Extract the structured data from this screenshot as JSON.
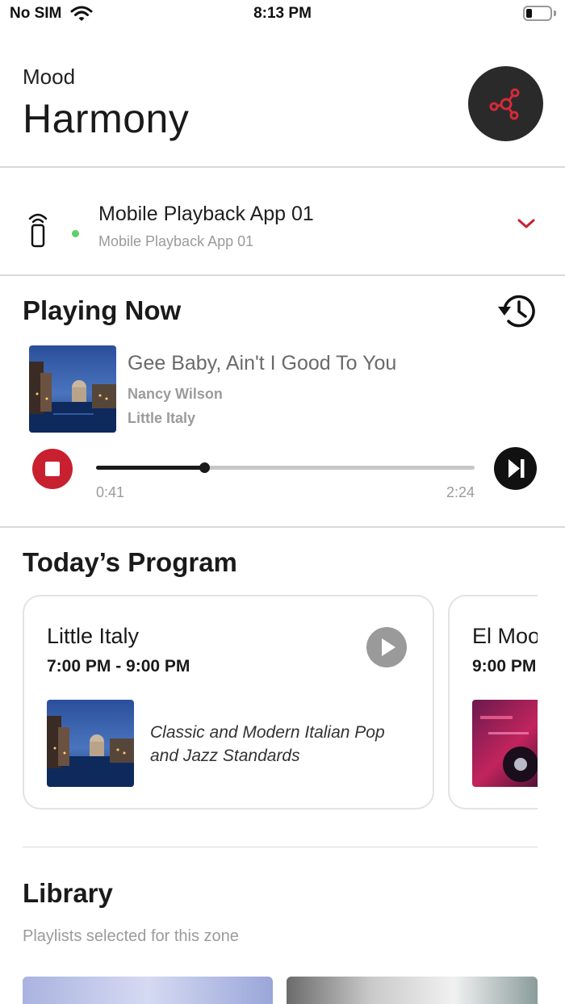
{
  "status_bar": {
    "carrier": "No SIM",
    "time": "8:13 PM",
    "battery_level": 0.25
  },
  "header": {
    "label": "Mood",
    "title": "Harmony",
    "mood_button_icon": "hub-network-icon"
  },
  "zone": {
    "name": "Mobile Playback App 01",
    "subtitle": "Mobile Playback App 01",
    "status_color": "#5ecf6b"
  },
  "playing_now": {
    "title": "Playing Now",
    "track": {
      "title": "Gee Baby, Ain't I Good To You",
      "artist": "Nancy Wilson",
      "playlist": "Little Italy"
    },
    "elapsed": "0:41",
    "duration": "2:24",
    "progress": 0.285
  },
  "program": {
    "title": "Today’s Program",
    "cards": [
      {
        "name": "Little Italy",
        "time": "7:00 PM - 9:00 PM",
        "description": "Classic and Modern Italian Pop and Jazz Standards"
      },
      {
        "name": "El Mood",
        "time": "9:00 PM",
        "description": ""
      }
    ]
  },
  "library": {
    "title": "Library",
    "subtitle": "Playlists selected for this zone"
  },
  "colors": {
    "accent": "#c8202f",
    "text": "#1a1a1a",
    "muted": "#9b9b9b",
    "divider": "#d9d9d9"
  }
}
